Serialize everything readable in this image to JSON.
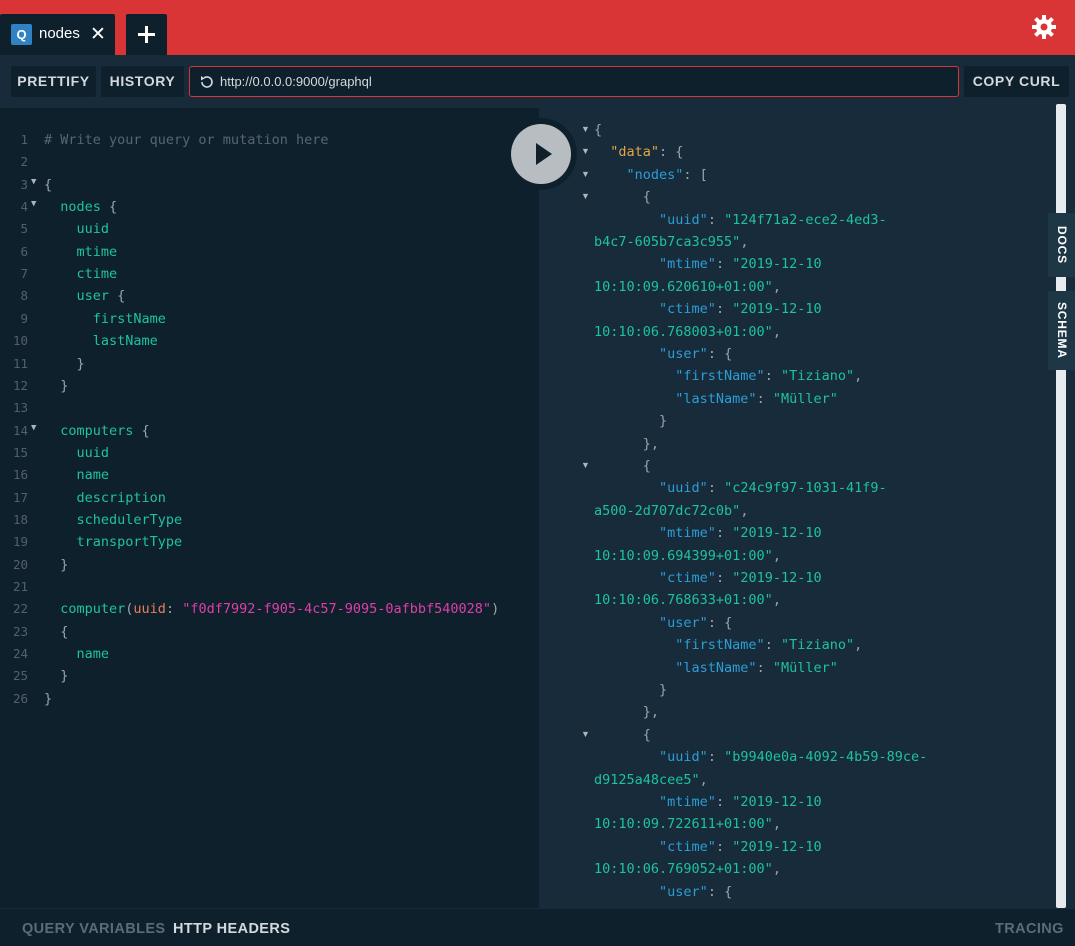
{
  "tabs": [
    {
      "badge": "Q",
      "name": "nodes",
      "close": "✕"
    }
  ],
  "toolbar": {
    "prettify": "PRETTIFY",
    "history": "HISTORY",
    "url": "http://0.0.0.0:9000/graphql",
    "copy_curl": "COPY CURL"
  },
  "side_tabs": {
    "docs": "DOCS",
    "schema": "SCHEMA"
  },
  "bottom": {
    "query_variables": "QUERY VARIABLES",
    "http_headers": "HTTP HEADERS",
    "tracing": "TRACING"
  },
  "colors": {
    "accent": "#da3536",
    "field": "#1fc1a2",
    "key": "#2d9dd6",
    "string_arg": "#df3fa7",
    "arg_name": "#e87e5c"
  },
  "editor_lines": [
    {
      "n": "1",
      "fold": false,
      "tokens": [
        {
          "t": "# Write your query or mutation here",
          "c": "comment"
        }
      ]
    },
    {
      "n": "2",
      "fold": false,
      "tokens": []
    },
    {
      "n": "3",
      "fold": true,
      "tokens": [
        {
          "t": "{",
          "c": "punct"
        }
      ]
    },
    {
      "n": "4",
      "fold": true,
      "tokens": [
        {
          "t": "  nodes",
          "c": "field"
        },
        {
          "t": " {",
          "c": "punct"
        }
      ]
    },
    {
      "n": "5",
      "fold": false,
      "tokens": [
        {
          "t": "    uuid",
          "c": "field"
        }
      ]
    },
    {
      "n": "6",
      "fold": false,
      "tokens": [
        {
          "t": "    mtime",
          "c": "field"
        }
      ]
    },
    {
      "n": "7",
      "fold": false,
      "tokens": [
        {
          "t": "    ctime",
          "c": "field"
        }
      ]
    },
    {
      "n": "8",
      "fold": false,
      "tokens": [
        {
          "t": "    user",
          "c": "field"
        },
        {
          "t": " {",
          "c": "punct"
        }
      ]
    },
    {
      "n": "9",
      "fold": false,
      "tokens": [
        {
          "t": "      firstName",
          "c": "field"
        }
      ]
    },
    {
      "n": "10",
      "fold": false,
      "tokens": [
        {
          "t": "      lastName",
          "c": "field"
        }
      ]
    },
    {
      "n": "11",
      "fold": false,
      "tokens": [
        {
          "t": "    }",
          "c": "punct"
        }
      ]
    },
    {
      "n": "12",
      "fold": false,
      "tokens": [
        {
          "t": "  }",
          "c": "punct"
        }
      ]
    },
    {
      "n": "13",
      "fold": false,
      "tokens": []
    },
    {
      "n": "14",
      "fold": true,
      "tokens": [
        {
          "t": "  computers",
          "c": "field"
        },
        {
          "t": " {",
          "c": "punct"
        }
      ]
    },
    {
      "n": "15",
      "fold": false,
      "tokens": [
        {
          "t": "    uuid",
          "c": "field"
        }
      ]
    },
    {
      "n": "16",
      "fold": false,
      "tokens": [
        {
          "t": "    name",
          "c": "field"
        }
      ]
    },
    {
      "n": "17",
      "fold": false,
      "tokens": [
        {
          "t": "    description",
          "c": "field"
        }
      ]
    },
    {
      "n": "18",
      "fold": false,
      "tokens": [
        {
          "t": "    schedulerType",
          "c": "field"
        }
      ]
    },
    {
      "n": "19",
      "fold": false,
      "tokens": [
        {
          "t": "    transportType",
          "c": "field"
        }
      ]
    },
    {
      "n": "20",
      "fold": false,
      "tokens": [
        {
          "t": "  }",
          "c": "punct"
        }
      ]
    },
    {
      "n": "21",
      "fold": false,
      "tokens": []
    },
    {
      "n": "22",
      "fold": false,
      "tokens": [
        {
          "t": "  computer",
          "c": "field"
        },
        {
          "t": "(",
          "c": "punct"
        },
        {
          "t": "uuid",
          "c": "arg"
        },
        {
          "t": ": ",
          "c": "punct"
        },
        {
          "t": "\"f0df7992-f905-4c57-9095-0afbbf540028\"",
          "c": "str"
        },
        {
          "t": ")",
          "c": "punct"
        }
      ]
    },
    {
      "n": "23",
      "fold": false,
      "tokens": [
        {
          "t": "  {",
          "c": "punct"
        }
      ]
    },
    {
      "n": "24",
      "fold": false,
      "tokens": [
        {
          "t": "    name",
          "c": "field"
        }
      ]
    },
    {
      "n": "25",
      "fold": false,
      "tokens": [
        {
          "t": "  }",
          "c": "punct"
        }
      ]
    },
    {
      "n": "26",
      "fold": false,
      "tokens": [
        {
          "t": "}",
          "c": "punct"
        }
      ]
    }
  ],
  "result_lines": [
    {
      "fold": true,
      "tokens": [
        {
          "t": "{",
          "c": "punct"
        }
      ]
    },
    {
      "fold": true,
      "tokens": [
        {
          "t": "  ",
          "c": "punct"
        },
        {
          "t": "\"data\"",
          "c": "data"
        },
        {
          "t": ": {",
          "c": "punct"
        }
      ]
    },
    {
      "fold": true,
      "tokens": [
        {
          "t": "    ",
          "c": "punct"
        },
        {
          "t": "\"nodes\"",
          "c": "key"
        },
        {
          "t": ": [",
          "c": "punct"
        }
      ]
    },
    {
      "fold": true,
      "tokens": [
        {
          "t": "      {",
          "c": "punct"
        }
      ]
    },
    {
      "fold": false,
      "tokens": [
        {
          "t": "        ",
          "c": "punct"
        },
        {
          "t": "\"uuid\"",
          "c": "key"
        },
        {
          "t": ": ",
          "c": "punct"
        },
        {
          "t": "\"124f71a2-ece2-4ed3-",
          "c": "str"
        }
      ]
    },
    {
      "fold": false,
      "tokens": [
        {
          "t": "b4c7-605b7ca3c955\"",
          "c": "str"
        },
        {
          "t": ",",
          "c": "punct"
        }
      ]
    },
    {
      "fold": false,
      "tokens": [
        {
          "t": "        ",
          "c": "punct"
        },
        {
          "t": "\"mtime\"",
          "c": "key"
        },
        {
          "t": ": ",
          "c": "punct"
        },
        {
          "t": "\"2019-12-10",
          "c": "str"
        }
      ]
    },
    {
      "fold": false,
      "tokens": [
        {
          "t": "10:10:09.620610+01:00\"",
          "c": "str"
        },
        {
          "t": ",",
          "c": "punct"
        }
      ]
    },
    {
      "fold": false,
      "tokens": [
        {
          "t": "        ",
          "c": "punct"
        },
        {
          "t": "\"ctime\"",
          "c": "key"
        },
        {
          "t": ": ",
          "c": "punct"
        },
        {
          "t": "\"2019-12-10",
          "c": "str"
        }
      ]
    },
    {
      "fold": false,
      "tokens": [
        {
          "t": "10:10:06.768003+01:00\"",
          "c": "str"
        },
        {
          "t": ",",
          "c": "punct"
        }
      ]
    },
    {
      "fold": false,
      "tokens": [
        {
          "t": "        ",
          "c": "punct"
        },
        {
          "t": "\"user\"",
          "c": "key"
        },
        {
          "t": ": {",
          "c": "punct"
        }
      ]
    },
    {
      "fold": false,
      "tokens": [
        {
          "t": "          ",
          "c": "punct"
        },
        {
          "t": "\"firstName\"",
          "c": "key"
        },
        {
          "t": ": ",
          "c": "punct"
        },
        {
          "t": "\"Tiziano\"",
          "c": "str"
        },
        {
          "t": ",",
          "c": "punct"
        }
      ]
    },
    {
      "fold": false,
      "tokens": [
        {
          "t": "          ",
          "c": "punct"
        },
        {
          "t": "\"lastName\"",
          "c": "key"
        },
        {
          "t": ": ",
          "c": "punct"
        },
        {
          "t": "\"Müller\"",
          "c": "str"
        }
      ]
    },
    {
      "fold": false,
      "tokens": [
        {
          "t": "        }",
          "c": "punct"
        }
      ]
    },
    {
      "fold": false,
      "tokens": [
        {
          "t": "      },",
          "c": "punct"
        }
      ]
    },
    {
      "fold": true,
      "tokens": [
        {
          "t": "      {",
          "c": "punct"
        }
      ]
    },
    {
      "fold": false,
      "tokens": [
        {
          "t": "        ",
          "c": "punct"
        },
        {
          "t": "\"uuid\"",
          "c": "key"
        },
        {
          "t": ": ",
          "c": "punct"
        },
        {
          "t": "\"c24c9f97-1031-41f9-",
          "c": "str"
        }
      ]
    },
    {
      "fold": false,
      "tokens": [
        {
          "t": "a500-2d707dc72c0b\"",
          "c": "str"
        },
        {
          "t": ",",
          "c": "punct"
        }
      ]
    },
    {
      "fold": false,
      "tokens": [
        {
          "t": "        ",
          "c": "punct"
        },
        {
          "t": "\"mtime\"",
          "c": "key"
        },
        {
          "t": ": ",
          "c": "punct"
        },
        {
          "t": "\"2019-12-10",
          "c": "str"
        }
      ]
    },
    {
      "fold": false,
      "tokens": [
        {
          "t": "10:10:09.694399+01:00\"",
          "c": "str"
        },
        {
          "t": ",",
          "c": "punct"
        }
      ]
    },
    {
      "fold": false,
      "tokens": [
        {
          "t": "        ",
          "c": "punct"
        },
        {
          "t": "\"ctime\"",
          "c": "key"
        },
        {
          "t": ": ",
          "c": "punct"
        },
        {
          "t": "\"2019-12-10",
          "c": "str"
        }
      ]
    },
    {
      "fold": false,
      "tokens": [
        {
          "t": "10:10:06.768633+01:00\"",
          "c": "str"
        },
        {
          "t": ",",
          "c": "punct"
        }
      ]
    },
    {
      "fold": false,
      "tokens": [
        {
          "t": "        ",
          "c": "punct"
        },
        {
          "t": "\"user\"",
          "c": "key"
        },
        {
          "t": ": {",
          "c": "punct"
        }
      ]
    },
    {
      "fold": false,
      "tokens": [
        {
          "t": "          ",
          "c": "punct"
        },
        {
          "t": "\"firstName\"",
          "c": "key"
        },
        {
          "t": ": ",
          "c": "punct"
        },
        {
          "t": "\"Tiziano\"",
          "c": "str"
        },
        {
          "t": ",",
          "c": "punct"
        }
      ]
    },
    {
      "fold": false,
      "tokens": [
        {
          "t": "          ",
          "c": "punct"
        },
        {
          "t": "\"lastName\"",
          "c": "key"
        },
        {
          "t": ": ",
          "c": "punct"
        },
        {
          "t": "\"Müller\"",
          "c": "str"
        }
      ]
    },
    {
      "fold": false,
      "tokens": [
        {
          "t": "        }",
          "c": "punct"
        }
      ]
    },
    {
      "fold": false,
      "tokens": [
        {
          "t": "      },",
          "c": "punct"
        }
      ]
    },
    {
      "fold": true,
      "tokens": [
        {
          "t": "      {",
          "c": "punct"
        }
      ]
    },
    {
      "fold": false,
      "tokens": [
        {
          "t": "        ",
          "c": "punct"
        },
        {
          "t": "\"uuid\"",
          "c": "key"
        },
        {
          "t": ": ",
          "c": "punct"
        },
        {
          "t": "\"b9940e0a-4092-4b59-89ce-",
          "c": "str"
        }
      ]
    },
    {
      "fold": false,
      "tokens": [
        {
          "t": "d9125a48cee5\"",
          "c": "str"
        },
        {
          "t": ",",
          "c": "punct"
        }
      ]
    },
    {
      "fold": false,
      "tokens": [
        {
          "t": "        ",
          "c": "punct"
        },
        {
          "t": "\"mtime\"",
          "c": "key"
        },
        {
          "t": ": ",
          "c": "punct"
        },
        {
          "t": "\"2019-12-10",
          "c": "str"
        }
      ]
    },
    {
      "fold": false,
      "tokens": [
        {
          "t": "10:10:09.722611+01:00\"",
          "c": "str"
        },
        {
          "t": ",",
          "c": "punct"
        }
      ]
    },
    {
      "fold": false,
      "tokens": [
        {
          "t": "        ",
          "c": "punct"
        },
        {
          "t": "\"ctime\"",
          "c": "key"
        },
        {
          "t": ": ",
          "c": "punct"
        },
        {
          "t": "\"2019-12-10",
          "c": "str"
        }
      ]
    },
    {
      "fold": false,
      "tokens": [
        {
          "t": "10:10:06.769052+01:00\"",
          "c": "str"
        },
        {
          "t": ",",
          "c": "punct"
        }
      ]
    },
    {
      "fold": false,
      "tokens": [
        {
          "t": "        ",
          "c": "punct"
        },
        {
          "t": "\"user\"",
          "c": "key"
        },
        {
          "t": ": {",
          "c": "punct"
        }
      ]
    }
  ]
}
